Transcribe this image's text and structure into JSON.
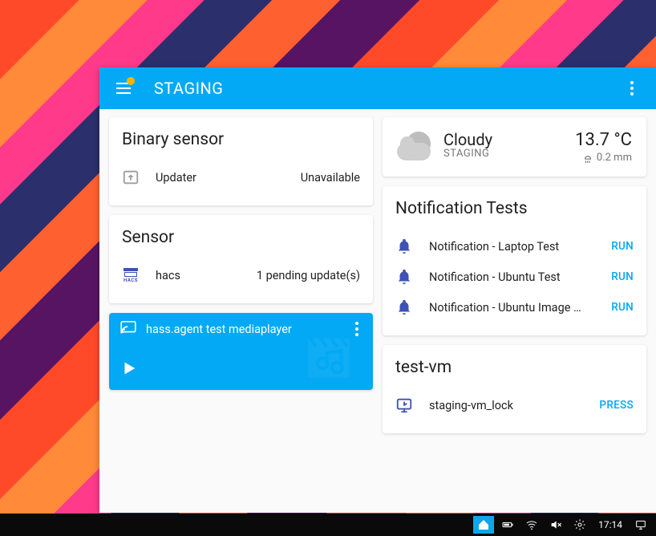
{
  "colors": {
    "accent": "#03a9f4",
    "action": "#03a9f4"
  },
  "appbar": {
    "title": "STAGING",
    "has_notification_dot": true
  },
  "left": {
    "binary_sensor": {
      "title": "Binary sensor",
      "items": [
        {
          "icon": "updater-icon",
          "label": "Updater",
          "value": "Unavailable"
        }
      ]
    },
    "sensor": {
      "title": "Sensor",
      "items": [
        {
          "icon": "hacs-icon",
          "label": "hacs",
          "value": "1 pending update(s)"
        }
      ]
    },
    "media": {
      "icon": "cast-icon",
      "title": "hass.agent test mediaplayer"
    }
  },
  "right": {
    "weather": {
      "condition": "Cloudy",
      "location": "STAGING",
      "temperature": "13.7 °C",
      "precipitation": "0.2 mm"
    },
    "notifications": {
      "title": "Notification Tests",
      "items": [
        {
          "label": "Notification - Laptop Test",
          "action": "RUN"
        },
        {
          "label": "Notification - Ubuntu Test",
          "action": "RUN"
        },
        {
          "label": "Notification - Ubuntu Image …",
          "action": "RUN"
        }
      ]
    },
    "testvm": {
      "title": "test-vm",
      "items": [
        {
          "icon": "lock-screen-icon",
          "label": "staging-vm_lock",
          "action": "PRESS"
        }
      ]
    }
  },
  "taskbar": {
    "clock": "17:14",
    "items": [
      "hass-tray-icon",
      "battery-icon",
      "wifi-icon",
      "volume-mute-icon",
      "settings-gear-icon"
    ]
  }
}
